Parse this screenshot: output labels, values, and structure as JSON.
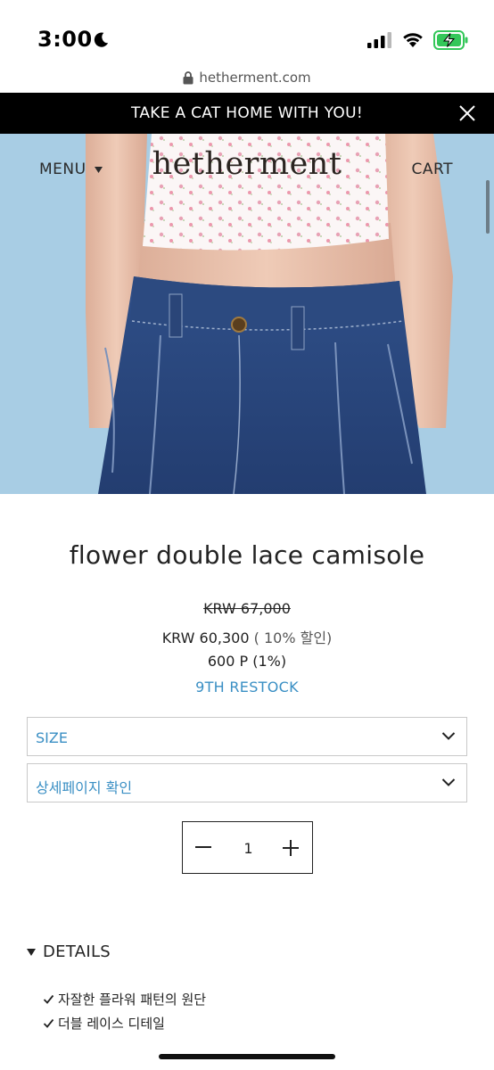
{
  "status_bar": {
    "time": "3:00",
    "icons": [
      "moon-icon",
      "signal-icon",
      "wifi-icon",
      "battery-charging-icon"
    ]
  },
  "browser": {
    "url": "hetherment.com",
    "icon": "lock-icon"
  },
  "announcement": {
    "text": "TAKE A CAT HOME WITH YOU!",
    "close_icon": "close-icon"
  },
  "header": {
    "menu_label": "MENU",
    "logo": "hetherment",
    "cart_label": "CART"
  },
  "product": {
    "title": "flower double lace camisole",
    "original_price": "KRW 67,000",
    "sale_price": "KRW 60,300",
    "discount": "( 10% 할인)",
    "points": "600 P (1%)",
    "restock": "9TH RESTOCK"
  },
  "options": {
    "size_label": "SIZE",
    "detail_page_label": "상세페이지 확인"
  },
  "quantity": {
    "value": "1"
  },
  "details": {
    "heading": "DETAILS",
    "items": [
      "자잘한 플라워 패턴의 원단",
      "더블 레이스 디테일"
    ]
  },
  "colors": {
    "accent_blue": "#3a8fc4",
    "announcement_bg": "#000000",
    "battery_green": "#34c759"
  }
}
